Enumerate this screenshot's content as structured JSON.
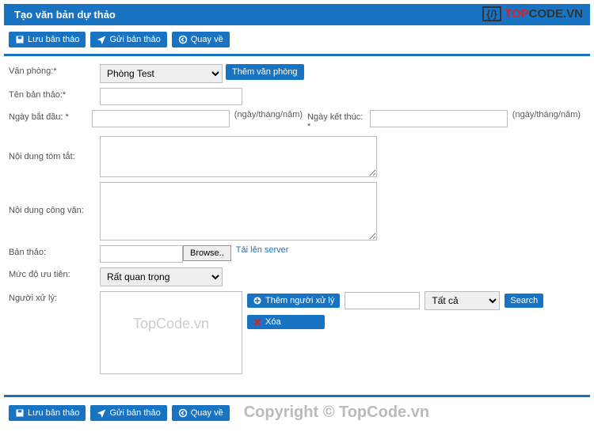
{
  "watermark": {
    "brand_t": "TOP",
    "brand_c": "CODE.VN",
    "center": "TopCode.vn",
    "copyright": "Copyright © TopCode.vn"
  },
  "header": {
    "title": "Tạo văn bản dự thảo"
  },
  "toolbar": {
    "save": "Lưu bản thảo",
    "send": "Gửi bản thảo",
    "back": "Quay về"
  },
  "form": {
    "office_label": "Văn phòng:*",
    "office_value": "Phòng Test",
    "office_add_btn": "Thêm văn phòng",
    "title_label": "Tên bản thảo:*",
    "title_value": "",
    "start_label": "Ngày bắt đầu: *",
    "start_value": "",
    "end_label": "Ngày kết thúc: *",
    "end_value": "",
    "date_hint": "(ngày/tháng/năm)",
    "summary_label": "Nội dung tóm tắt:",
    "summary_value": "",
    "content_label": "Nội dung công văn:",
    "content_value": "",
    "draft_label": "Bản thảo:",
    "file_value": "",
    "browse_btn": "Browse..",
    "upload_link": "Tải lên server",
    "priority_label": "Mức độ ưu tiên:",
    "priority_value": "Rất quan trọng",
    "handlers_label": "Người xử lý:",
    "add_handler_btn": "Thêm người xử lý",
    "delete_btn": "Xóa",
    "search_input": "",
    "search_filter": "Tất cả",
    "search_btn": "Search"
  }
}
